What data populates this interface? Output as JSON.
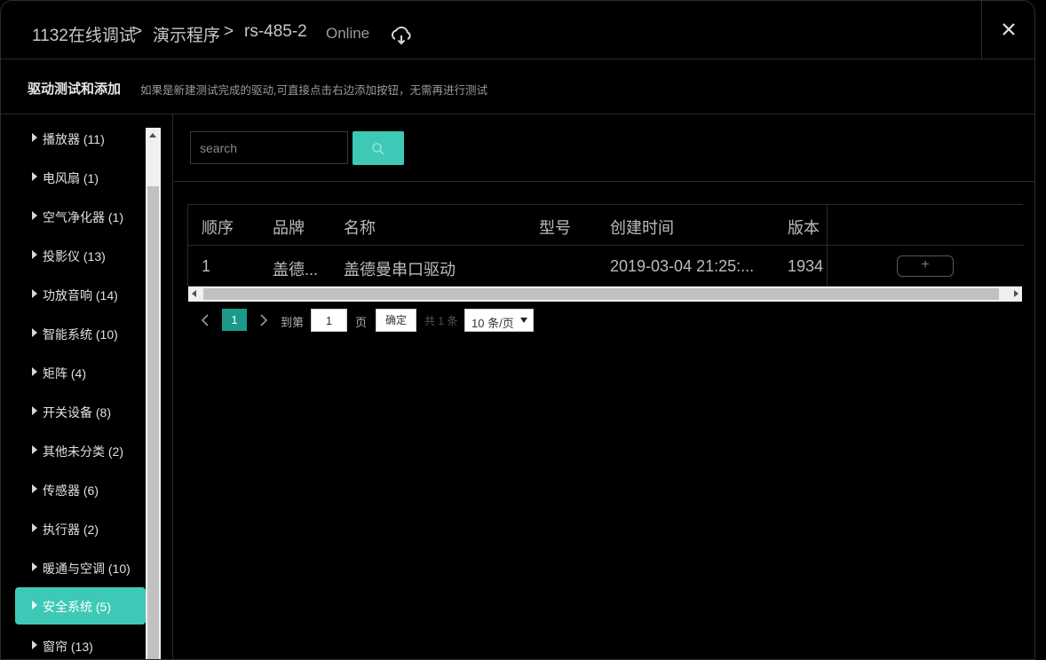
{
  "breadcrumb": {
    "items": [
      "1132在线调试",
      "演示程序",
      "rs-485-2"
    ],
    "separator": ">",
    "status": "Online"
  },
  "icons": {
    "cloud": "cloud-sync-icon",
    "close": "close-icon",
    "search": "search-icon"
  },
  "subheader": {
    "title": "驱动测试和添加",
    "hint": "如果是新建测试完成的驱动,可直接点击右边添加按钮，无需再进行测试"
  },
  "sidebar": {
    "items": [
      {
        "label": "播放器 (11)"
      },
      {
        "label": "电风扇 (1)"
      },
      {
        "label": "空气净化器 (1)"
      },
      {
        "label": "投影仪 (13)"
      },
      {
        "label": "功放音响 (14)"
      },
      {
        "label": "智能系统 (10)"
      },
      {
        "label": "矩阵 (4)"
      },
      {
        "label": "开关设备 (8)"
      },
      {
        "label": "其他未分类 (2)"
      },
      {
        "label": "传感器 (6)"
      },
      {
        "label": "执行器 (2)"
      },
      {
        "label": "暖通与空调 (10)"
      },
      {
        "label": "安全系统 (5)",
        "active": true
      },
      {
        "label": "窗帘 (13)"
      }
    ]
  },
  "search": {
    "placeholder": "search"
  },
  "table": {
    "columns": [
      "顺序",
      "品牌",
      "名称",
      "型号",
      "创建时间",
      "版本"
    ],
    "rows": [
      {
        "order": "1",
        "brand": "盖德...",
        "name": "盖德曼串口驱动",
        "model": "",
        "created": "2019-03-04 21:25:...",
        "version": "1934",
        "action": "+"
      }
    ]
  },
  "pagination": {
    "current": "1",
    "goto_label": "到第",
    "goto_value": "1",
    "page_suffix": "页",
    "confirm": "确定",
    "total": "共 1 条",
    "page_size": "10 条/页"
  },
  "colors": {
    "accent": "#3ec9b6",
    "page_active": "#1a9b8a",
    "background": "#000000"
  }
}
